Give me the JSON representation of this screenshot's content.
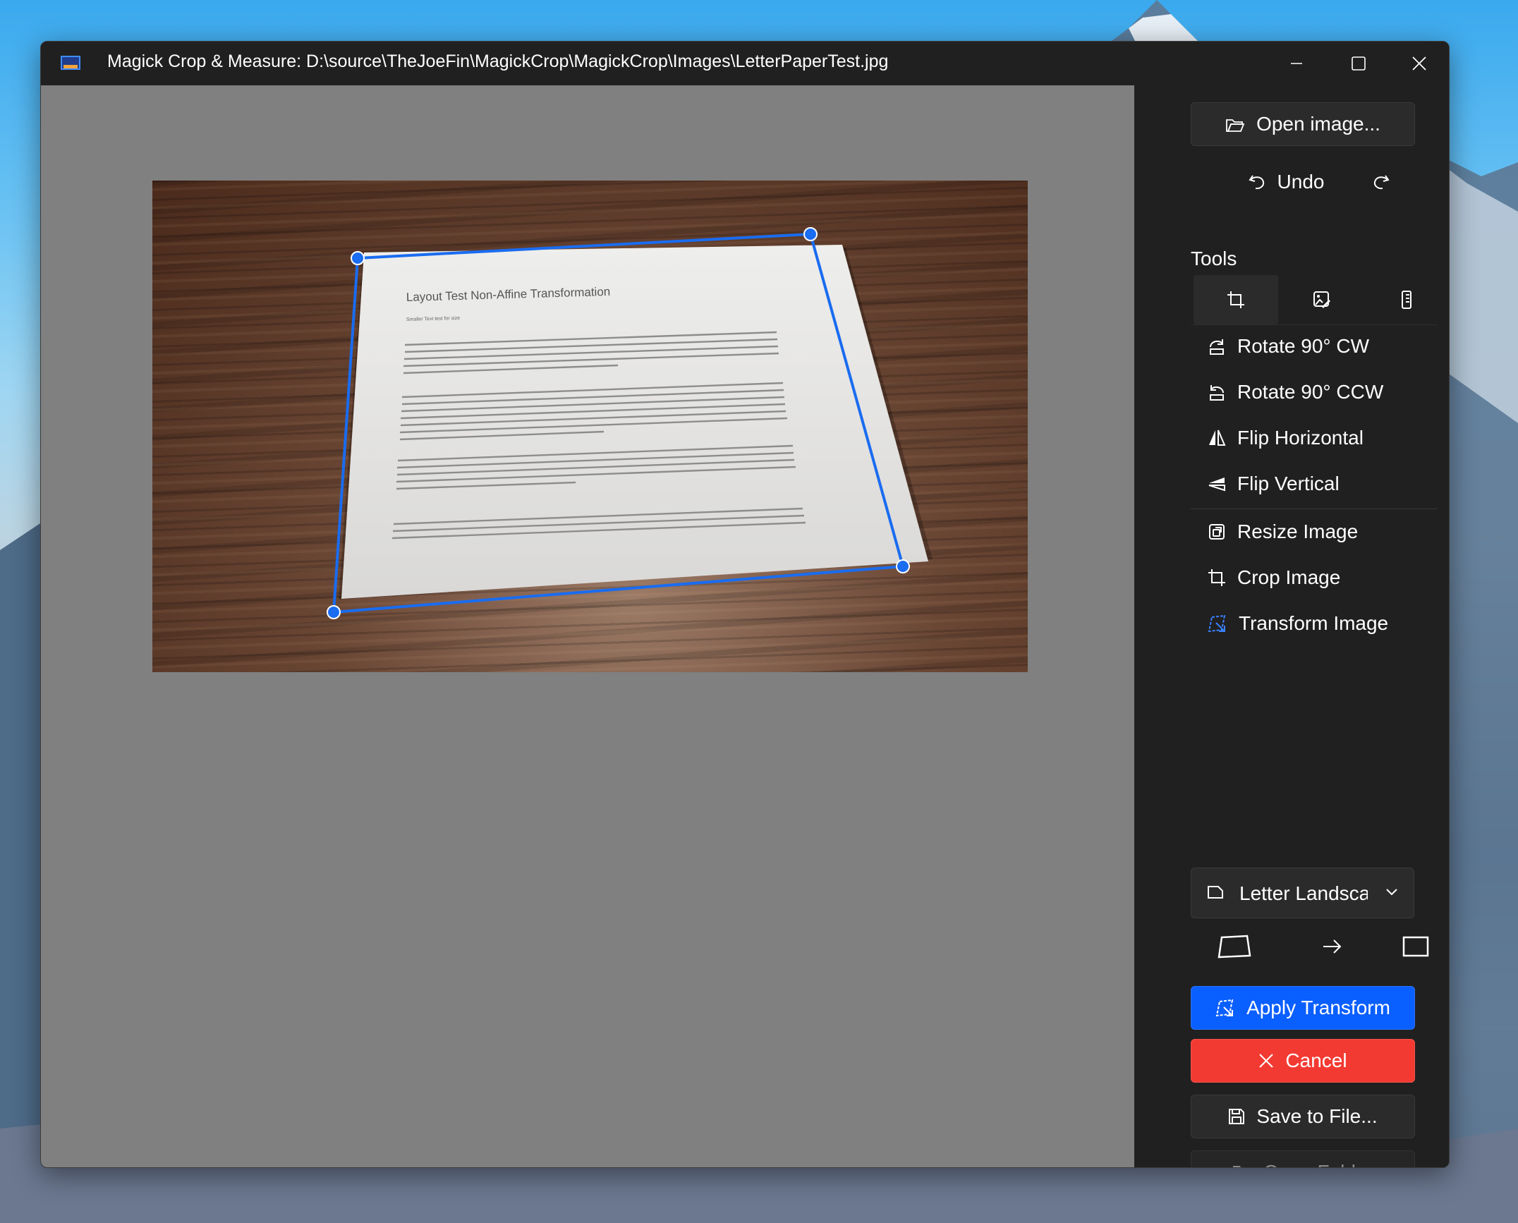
{
  "window": {
    "title": "Magick Crop & Measure: D:\\source\\TheJoeFin\\MagickCrop\\MagickCrop\\Images\\LetterPaperTest.jpg"
  },
  "document": {
    "heading": "Layout Test Non-Affine Transformation",
    "subheading": "Smaller Text test for size"
  },
  "sidebar": {
    "open_image_label": "Open image...",
    "undo_label": "Undo",
    "tools_label": "Tools",
    "tabs": [
      {
        "icon": "crop-icon",
        "active": true
      },
      {
        "icon": "image-edit-icon",
        "active": false
      },
      {
        "icon": "ruler-icon",
        "active": false
      }
    ],
    "actions": [
      {
        "label": "Rotate 90° CW",
        "icon": "rotate-cw-icon"
      },
      {
        "label": "Rotate 90° CCW",
        "icon": "rotate-ccw-icon"
      },
      {
        "label": "Flip Horizontal",
        "icon": "flip-horizontal-icon"
      },
      {
        "label": "Flip Vertical",
        "icon": "flip-vertical-icon"
      },
      {
        "label": "Resize Image",
        "icon": "resize-icon"
      },
      {
        "label": "Crop Image",
        "icon": "crop-icon"
      },
      {
        "label": "Transform Image",
        "icon": "transform-icon"
      }
    ],
    "paper_size_selected": "Letter Landscape",
    "apply_transform_label": "Apply Transform",
    "cancel_label": "Cancel",
    "save_label": "Save to File...",
    "open_folder_label": "Open Folder"
  },
  "colors": {
    "accent": "#0a5fff",
    "danger": "#f33a32",
    "handle": "#1a6cf0",
    "canvas": "#808080",
    "panel": "#202020"
  }
}
